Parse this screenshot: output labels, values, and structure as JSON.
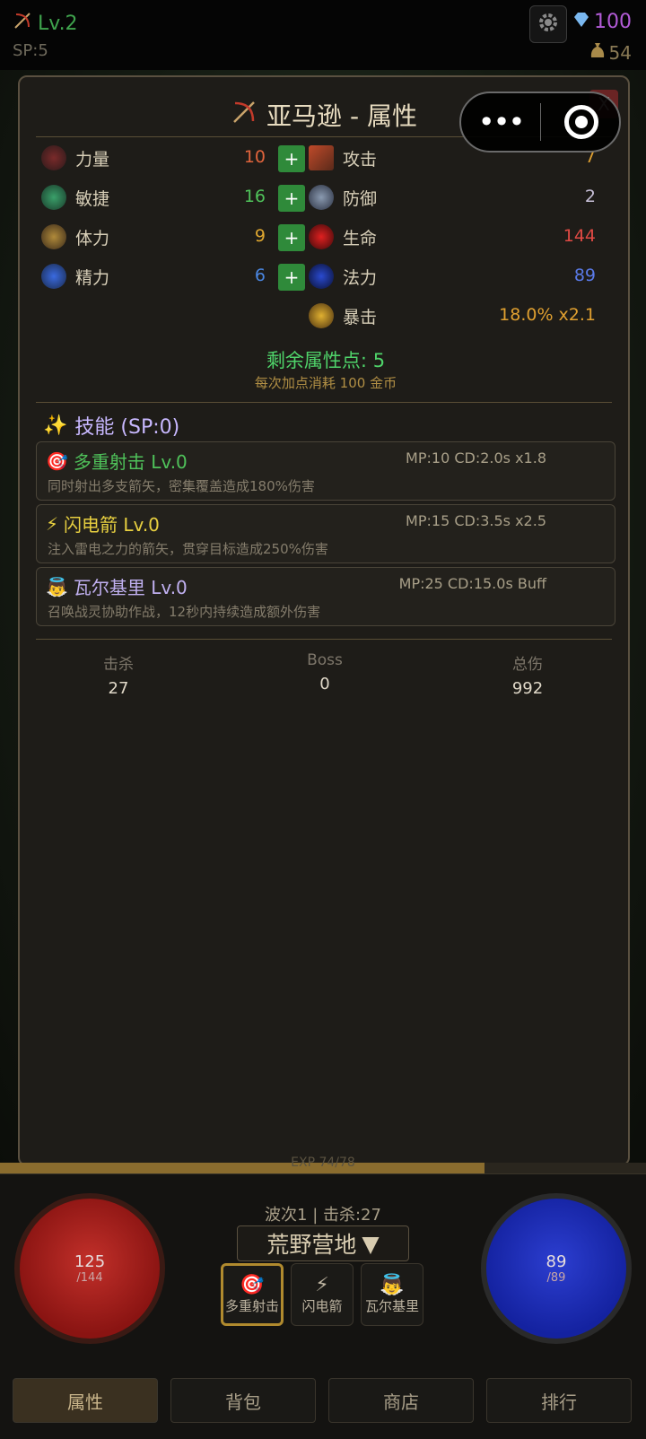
{
  "header": {
    "level": "Lv.2",
    "sp": "SP:5",
    "gems": "100",
    "gold": "54"
  },
  "panel": {
    "title": "亚马逊 - 属性",
    "close": "X",
    "capsule_dots": "•••",
    "base_stats": [
      {
        "label": "力量",
        "value": "10",
        "plus": "+",
        "color": "#e0643c"
      },
      {
        "label": "敏捷",
        "value": "16",
        "plus": "+",
        "color": "#4fc25a"
      },
      {
        "label": "体力",
        "value": "9",
        "plus": "+",
        "color": "#e0a830"
      },
      {
        "label": "精力",
        "value": "6",
        "plus": "+",
        "color": "#4a86e0"
      }
    ],
    "derived_stats": [
      {
        "label": "攻击",
        "value": "7",
        "color": "#e0a030"
      },
      {
        "label": "防御",
        "value": "2",
        "color": "#c8c0d8"
      },
      {
        "label": "生命",
        "value": "144",
        "color": "#e04a44"
      },
      {
        "label": "法力",
        "value": "89",
        "color": "#5a7ae8"
      },
      {
        "label": "暴击",
        "value": "18.0%  x2.1",
        "color": "#e0a030"
      }
    ],
    "remaining": "剩余属性点: 5",
    "cost_note": "每次加点消耗 100 金币",
    "skills_heading": "技能 (SP:0)",
    "skills": [
      {
        "icon": "🎯",
        "name": "多重射击 Lv.0",
        "meta": "MP:10 CD:2.0s x1.8",
        "desc": "同时射出多支箭矢，密集覆盖造成180%伤害",
        "color": "#4fc25a"
      },
      {
        "icon": "⚡",
        "name": "闪电箭 Lv.0",
        "meta": "MP:15 CD:3.5s x2.5",
        "desc": "注入雷电之力的箭矢，贯穿目标造成250%伤害",
        "color": "#e8d040"
      },
      {
        "icon": "👼",
        "name": "瓦尔基里 Lv.0",
        "meta": "MP:25 CD:15.0s Buff",
        "desc": "召唤战灵协助作战，12秒内持续造成额外伤害",
        "color": "#c0b0f0"
      }
    ],
    "totals": [
      {
        "label": "击杀",
        "value": "27"
      },
      {
        "label": "Boss",
        "value": "0"
      },
      {
        "label": "总伤",
        "value": "992"
      }
    ]
  },
  "exp": {
    "text": "EXP 74/78",
    "fraction": 0.75
  },
  "hud": {
    "hp_current": "125",
    "hp_max": "/144",
    "mp_current": "89",
    "mp_max": "/89",
    "wave": "波次1 | 击杀:27",
    "zone": "荒野营地",
    "zone_arrow": "▼",
    "skills": [
      {
        "icon": "🎯",
        "label": "多重射击"
      },
      {
        "icon": "⚡",
        "label": "闪电箭"
      },
      {
        "icon": "👼",
        "label": "瓦尔基里"
      }
    ]
  },
  "tabs": [
    "属性",
    "背包",
    "商店",
    "排行"
  ]
}
